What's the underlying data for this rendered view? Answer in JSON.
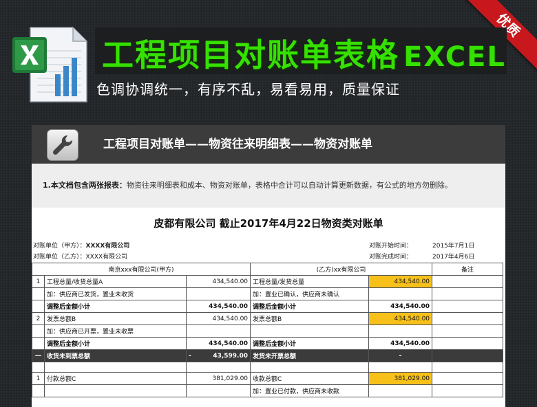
{
  "ribbon": {
    "label": "优质"
  },
  "header": {
    "title": "工程项目对账单表格",
    "title_suffix": "EXCEL",
    "subtitle": "色调协调统一，有序不乱，易看易用，质量保证"
  },
  "panel": {
    "title": "工程项目对账单——物资往来明细表——物资对账单",
    "notice_bold": "1.本文档包含两张报表：",
    "notice_text": "物资往来明细表和成本、物资对账单，表格中合计可以自动计算更新数据，有公式的地方勿删除。"
  },
  "sheet": {
    "title": "皮都有限公司 截止2017年4月22日物资类对账单",
    "party_a_label": "对账单位（甲方）：",
    "party_a_value": "XXXX有限公司",
    "party_b_label": "对账单位（乙方）：",
    "party_b_value": "XXXX有限公司",
    "start_label": "对账开始时间：",
    "start_value": "2015年7月1日",
    "end_label": "对账完成时间：",
    "end_value": "2017年4月6日"
  },
  "table": {
    "header": {
      "party_a": "南京xxx有限公司(甲方)",
      "party_b": "(乙方)xx有限公司",
      "remark": "备注"
    },
    "rows": [
      {
        "no": "1",
        "a_item": "工程总量/收货总量A",
        "a_val": "434,540.00",
        "b_item": "工程总量/发货总量",
        "b_val": "434,540.00"
      },
      {
        "no": "",
        "a_item": "加：供应商已发货，置业未收货",
        "a_val": "",
        "b_item": "加：置业已确认，供应商未确认",
        "b_val": ""
      },
      {
        "no": "",
        "a_item": "调整后金额小计",
        "a_val": "434,540.00",
        "b_item": "调整后金额小计",
        "b_val": "434,540.00"
      },
      {
        "no": "2",
        "a_item": "发票总额B",
        "a_val": "434,540.00",
        "b_item": "发票总额B",
        "b_val": "434,540.00"
      },
      {
        "no": "",
        "a_item": "加：供应商已开票，置业未收票",
        "a_val": "",
        "b_item": "",
        "b_val": ""
      },
      {
        "no": "",
        "a_item": "调整后金额小计",
        "a_val": "434,540.00",
        "b_item": "调整后金额小计",
        "b_val": "434,540.00"
      },
      {
        "no": "一",
        "a_item": "收货未到票总额",
        "a_dash": "-",
        "a_val": "43,599.00",
        "b_item": "发货未开票总额",
        "b_val": "-"
      },
      {
        "no": "1",
        "a_item": "付款总额C",
        "a_val": "381,029.00",
        "b_item": "收款总额C",
        "b_val": "381,029.00"
      },
      {
        "no": "",
        "a_item": "",
        "a_val": "",
        "b_item": "加：置业已付款，供应商未收款",
        "b_val": ""
      }
    ]
  }
}
